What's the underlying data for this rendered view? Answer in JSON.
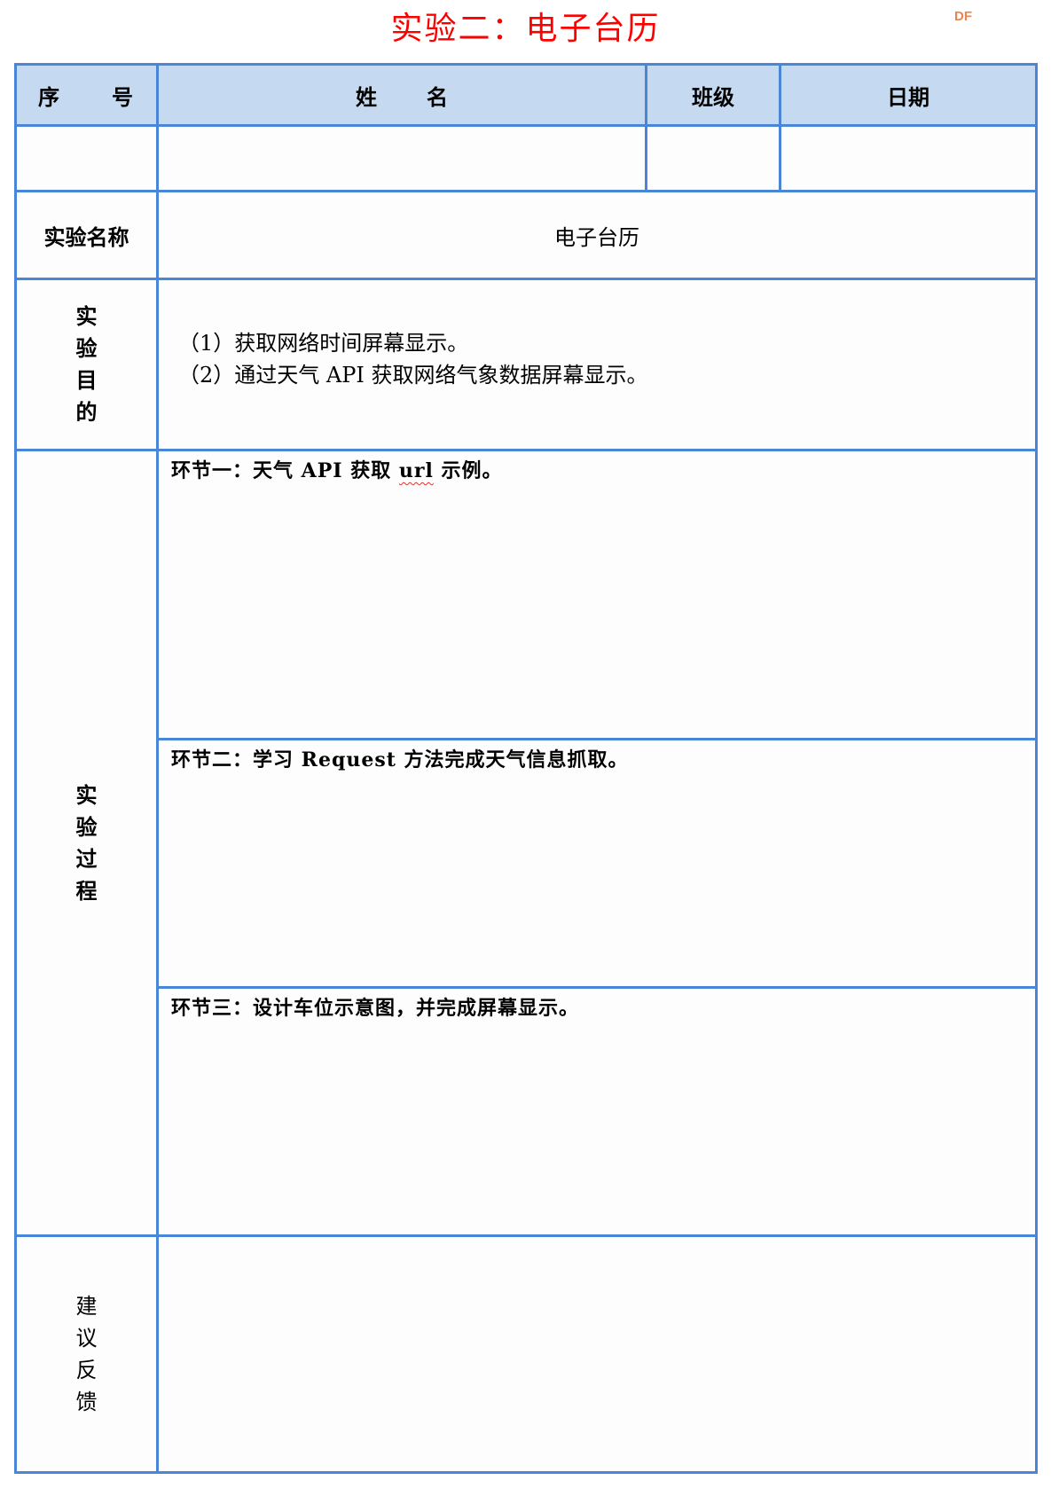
{
  "title": "实验二：电子台历",
  "watermark": "DF",
  "colors": {
    "title": "#ff0000",
    "border": "#4a86d8",
    "header_fill": "#c5d9f1",
    "watermark": "#e8864f",
    "spellcheck": "#e03030"
  },
  "header": {
    "seq_chars": [
      "序",
      "号"
    ],
    "name_chars": [
      "姓",
      "名"
    ],
    "class_label": "班级",
    "date_label": "日期"
  },
  "info_row": {
    "seq": "",
    "name": "",
    "class": "",
    "date": ""
  },
  "experiment_name": {
    "label": "实验名称",
    "value": "电子台历"
  },
  "purpose": {
    "label_chars": [
      "实",
      "验",
      "目",
      "的"
    ],
    "items": [
      "（1）获取网络时间屏幕显示。",
      "（2）通过天气 API 获取网络气象数据屏幕显示。"
    ]
  },
  "process": {
    "label_chars": [
      "实",
      "验",
      "过",
      "程"
    ],
    "steps": [
      {
        "prefix": "环节一：天气 API 获取 ",
        "flagged_word": "url",
        "suffix": " 示例。"
      },
      {
        "text": "环节二：学习 Request 方法完成天气信息抓取。"
      },
      {
        "text": "环节三：设计车位示意图，并完成屏幕显示。"
      }
    ]
  },
  "feedback": {
    "label_chars": [
      "建",
      "议",
      "反",
      "馈"
    ],
    "content": ""
  }
}
